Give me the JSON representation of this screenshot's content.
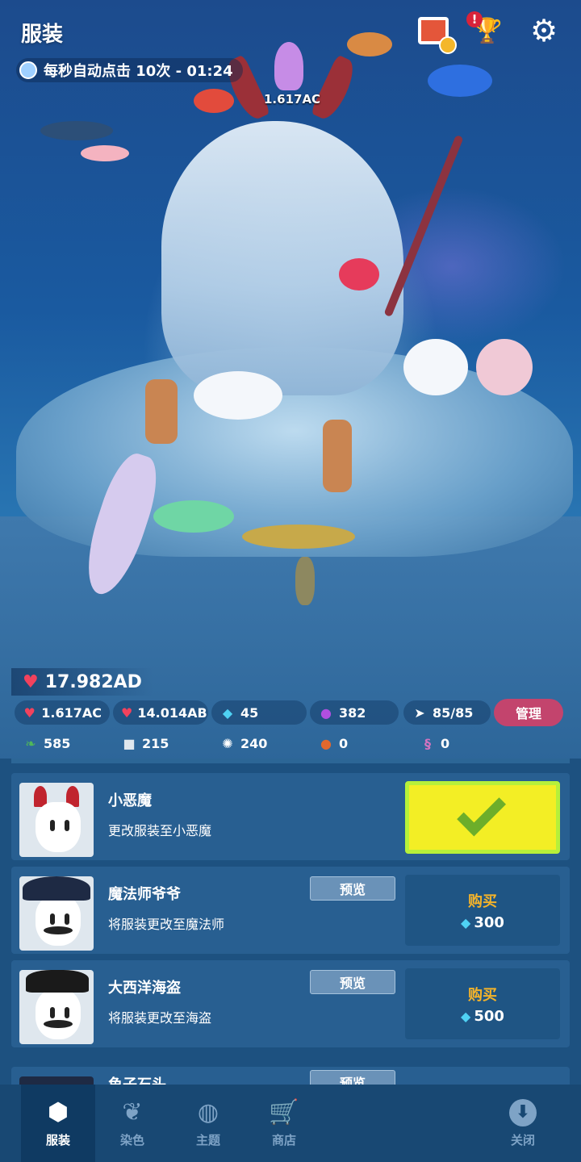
{
  "header": {
    "title": "服装",
    "auto_click_text": "每秒自动点击 10次 - 01:24",
    "icons": [
      "photo-album-icon",
      "trophy-icon",
      "settings-gear-icon"
    ],
    "trophy_alert": "!"
  },
  "scene": {
    "center_score": "1.617AC"
  },
  "stats": {
    "hearts_total": "17.982AD",
    "tap_value": "1.617AC",
    "per_second": "14.014AB",
    "gems": "45",
    "pearls": "382",
    "fish_count": "85/85",
    "manage_label": "管理",
    "seaweed": "585",
    "rock": "215",
    "urchin": "240",
    "crab": "0",
    "seahorse": "0"
  },
  "costumes": [
    {
      "name": "小恶魔",
      "desc": "更改服装至小恶魔",
      "state": "selected"
    },
    {
      "name": "魔法师爷爷",
      "desc": "将服装更改至魔法师",
      "preview_label": "预览",
      "buy_label": "购买",
      "price": "300",
      "state": "buy"
    },
    {
      "name": "大西洋海盗",
      "desc": "将服装更改至海盗",
      "preview_label": "预览",
      "buy_label": "购买",
      "price": "500",
      "state": "buy"
    },
    {
      "name": "鱼子石头",
      "preview_label": "预览",
      "state": "partial"
    }
  ],
  "nav": {
    "costume": "服装",
    "dye": "染色",
    "theme": "主题",
    "shop": "商店",
    "close": "关闭"
  },
  "colors": {
    "accent_yellow": "#f3ee25",
    "buy_gold": "#f4b32a",
    "manage_pink": "#c3446d",
    "heart_red": "#f2425d",
    "gem_cyan": "#4fd2f4"
  }
}
